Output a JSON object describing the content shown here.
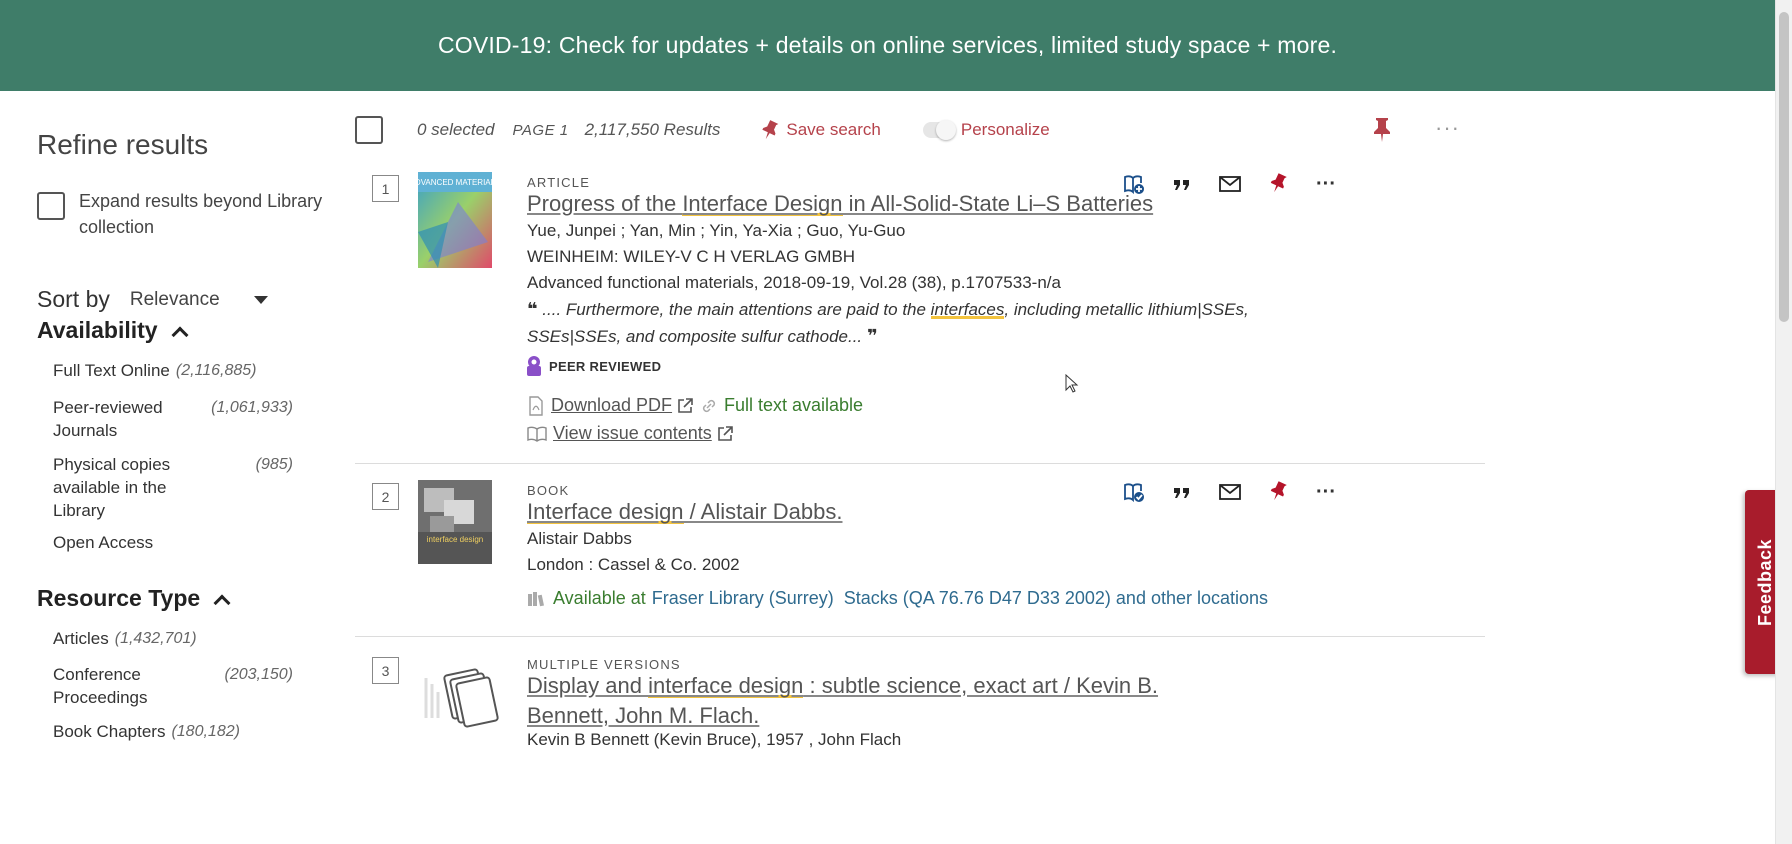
{
  "banner": {
    "text": "COVID-19: Check for updates + details on online services, limited study space + more."
  },
  "sidebar": {
    "title": "Refine results",
    "expand_label": "Expand results beyond Library collection",
    "sort_label": "Sort by",
    "sort_value": "Relevance",
    "availability": {
      "title": "Availability",
      "items": [
        {
          "label": "Full Text Online",
          "count": "(2,116,885)"
        },
        {
          "label": "Peer-reviewed Journals",
          "count": "(1,061,933)"
        },
        {
          "label": "Physical copies available in the Library",
          "count": "(985)"
        },
        {
          "label": "Open Access",
          "count": ""
        }
      ]
    },
    "resource_type": {
      "title": "Resource Type",
      "items": [
        {
          "label": "Articles",
          "count": "(1,432,701)"
        },
        {
          "label": "Conference Proceedings",
          "count": "(203,150)"
        },
        {
          "label": "Book Chapters",
          "count": "(180,182)"
        }
      ]
    }
  },
  "toolbar": {
    "selected": "0 selected",
    "page": "PAGE 1",
    "results": "2,117,550 Results",
    "save_search": "Save search",
    "personalize": "Personalize",
    "more": "···"
  },
  "results": [
    {
      "num": "1",
      "cover_text": "ADVANCED MATERIALS",
      "type": "ARTICLE",
      "title_pre": "Progress of the ",
      "title_hl": "Interface Design",
      "title_post": " in All-Solid-State Li–S Batteries",
      "authors": "Yue, Junpei ; Yan, Min ; Yin, Ya-Xia ; Guo, Yu-Guo",
      "publisher": "WEINHEIM: WILEY-V C H VERLAG GMBH",
      "source": "Advanced functional materials, 2018-09-19, Vol.28 (38), p.1707533-n/a",
      "snippet_pre": " .... Furthermore, the main attentions are paid to the ",
      "snippet_hl": "interfaces",
      "snippet_post": ", including metallic lithium|SSEs, SSEs|SSEs, and composite sulfur cathode...",
      "peer": "PEER REVIEWED",
      "download": "Download PDF",
      "fulltext": "Full text available",
      "issue": "View issue contents"
    },
    {
      "num": "2",
      "cover_text": "interface design",
      "type": "BOOK",
      "title_hl": "Interface design",
      "title_post": " / Alistair Dabbs.",
      "authors": "Alistair Dabbs",
      "publisher": "London : Cassel & Co. 2002",
      "avail_prefix": "Available at",
      "avail_library": "Fraser Library (Surrey)",
      "avail_location": "Stacks (QA 76.76 D47 D33 2002) and other locations"
    },
    {
      "num": "3",
      "type": "MULTIPLE VERSIONS",
      "title_pre": "Display and ",
      "title_hl": "interface design",
      "title_post": " : subtle science, exact art / Kevin B. Bennett, John M. Flach.",
      "authors": "Kevin B Bennett (Kevin Bruce), 1957 , John Flach"
    }
  ],
  "feedback": "Feedback",
  "colors": {
    "banner": "#3f7d69",
    "accent_red": "#b5424b",
    "feedback": "#a81c2c",
    "green": "#3a7d2f",
    "link_blue": "#2f6b8f",
    "highlight": "#f3c33d"
  }
}
